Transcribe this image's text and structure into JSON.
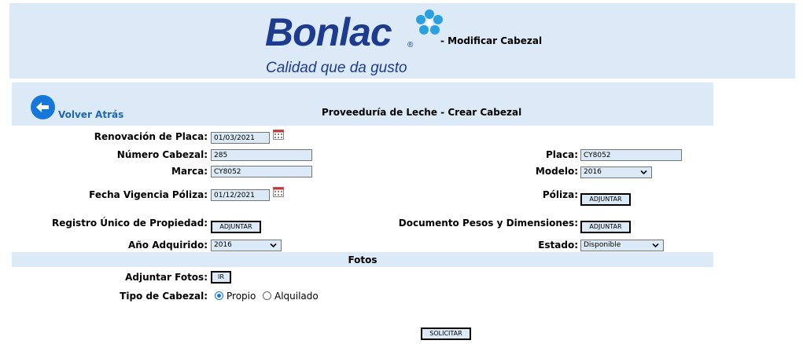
{
  "header": {
    "logo_text": "Bonlac",
    "logo_registered": "®",
    "logo_tagline": "Calidad que da gusto",
    "title": "- Modificar Cabezal"
  },
  "nav": {
    "back_label": "Volver Atrás",
    "back_icon": "arrow-left-circle-icon",
    "page_title": "Proveeduría de Leche - Crear Cabezal"
  },
  "form": {
    "renovacion": {
      "label": "Renovación de Placa:",
      "value": "01/03/2021"
    },
    "numero_cabezal": {
      "label": "Número Cabezal:",
      "value": "285"
    },
    "placa": {
      "label": "Placa:",
      "value": "CY8052"
    },
    "marca": {
      "label": "Marca:",
      "value": "CY8052"
    },
    "modelo": {
      "label": "Modelo:",
      "value": "2016"
    },
    "fecha_poliza": {
      "label": "Fecha Vigencia Póliza:",
      "value": "01/12/2021"
    },
    "poliza": {
      "label": "Póliza:",
      "button": "ADJUNTAR"
    },
    "registro": {
      "label": "Registro Único de Propiedad:",
      "button": "ADJUNTAR"
    },
    "documento_pesos": {
      "label": "Documento Pesos y Dimensiones:",
      "button": "ADJUNTAR"
    },
    "anio": {
      "label": "Año Adquirido:",
      "value": "2016"
    },
    "estado": {
      "label": "Estado:",
      "value": "Disponible"
    }
  },
  "fotos": {
    "section_title": "Fotos",
    "adjuntar_label": "Adjuntar Fotos:",
    "adjuntar_button": "IR",
    "tipo_label": "Tipo de Cabezal:",
    "options": [
      "Propio",
      "Alquilado"
    ],
    "selected": "Propio"
  },
  "submit_label": "SOLICITAR",
  "colors": {
    "panel": "#dce9f6",
    "brand": "#1d3b8f",
    "link": "#1d66b8",
    "accent": "#1477d9"
  }
}
